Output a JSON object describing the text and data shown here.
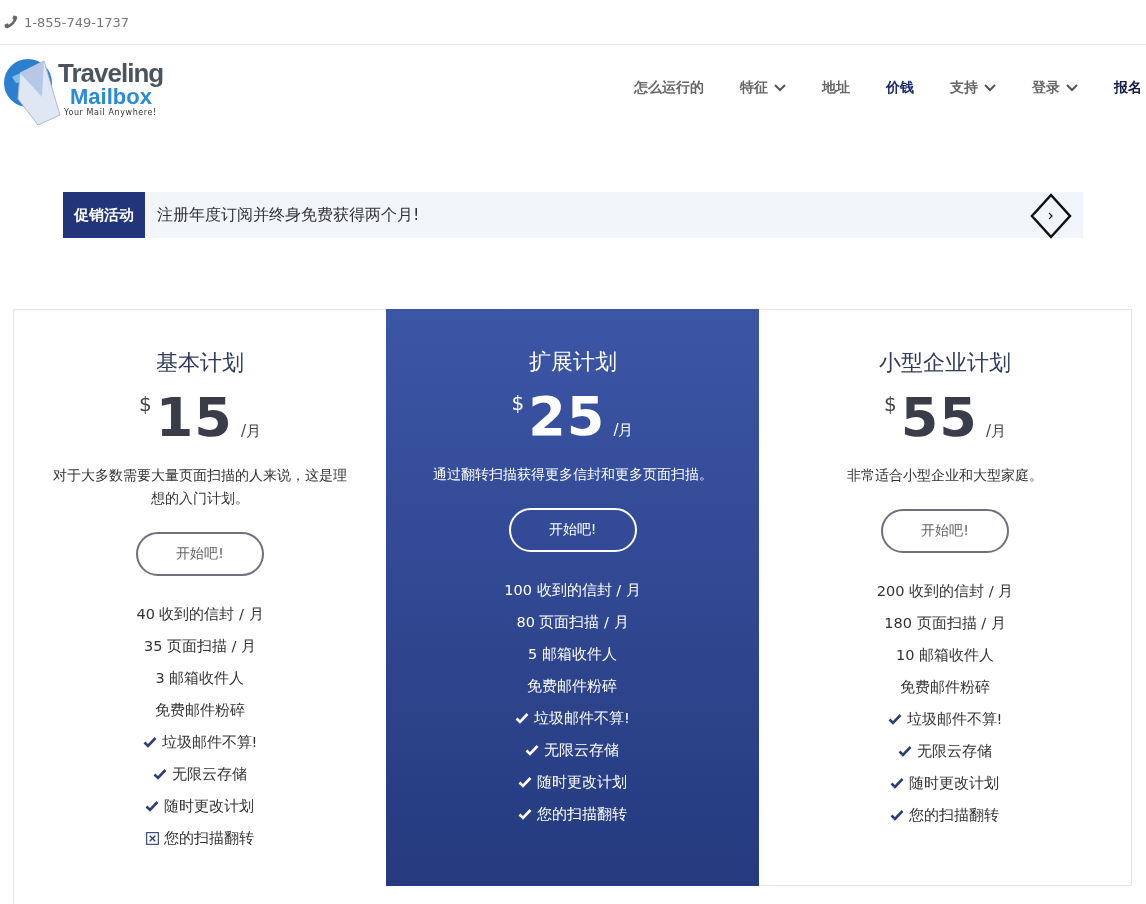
{
  "top_bar": {
    "phone": "1-855-749-1737"
  },
  "logo": {
    "line1": "Traveling",
    "line2": "Mailbox",
    "tagline": "Your Mail Anywhere!"
  },
  "nav": [
    {
      "label": "怎么运行的",
      "kind": "link",
      "selected": false
    },
    {
      "label": "特征",
      "kind": "dropdown",
      "selected": false
    },
    {
      "label": "地址",
      "kind": "link",
      "selected": false
    },
    {
      "label": "价钱",
      "kind": "link",
      "selected": true
    },
    {
      "label": "支持",
      "kind": "dropdown",
      "selected": false
    },
    {
      "label": "登录",
      "kind": "dropdown",
      "selected": false
    },
    {
      "label": "报名",
      "kind": "cta",
      "selected": false
    }
  ],
  "promo": {
    "tag": "促销活动",
    "text": "注册年度订阅并终身免费获得两个月!"
  },
  "plans": [
    {
      "name": "基本计划",
      "currency": "$",
      "price": "15",
      "period": "/月",
      "description": "对于大多数需要大量页面扫描的人来说，这是理想的入门计划。",
      "button": "开始吧!",
      "highlighted": false,
      "features": [
        {
          "text": "40 收到的信封 / 月",
          "kind": "plain"
        },
        {
          "text": "35 页面扫描 / 月",
          "kind": "plain"
        },
        {
          "text": "3 邮箱收件人",
          "kind": "plain"
        },
        {
          "text": "免费邮件粉碎",
          "kind": "plain"
        },
        {
          "text": "垃圾邮件不算!",
          "kind": "check"
        },
        {
          "text": "无限云存储",
          "kind": "check"
        },
        {
          "text": "随时更改计划",
          "kind": "check"
        },
        {
          "text": "您的扫描翻转",
          "kind": "cross"
        }
      ]
    },
    {
      "name": "扩展计划",
      "currency": "$",
      "price": "25",
      "period": "/月",
      "description": "通过翻转扫描获得更多信封和更多页面扫描。",
      "button": "开始吧!",
      "highlighted": true,
      "features": [
        {
          "text": "100 收到的信封 / 月",
          "kind": "plain"
        },
        {
          "text": "80 页面扫描 / 月",
          "kind": "plain"
        },
        {
          "text": "5 邮箱收件人",
          "kind": "plain"
        },
        {
          "text": "免费邮件粉碎",
          "kind": "plain"
        },
        {
          "text": "垃圾邮件不算!",
          "kind": "check"
        },
        {
          "text": "无限云存储",
          "kind": "check"
        },
        {
          "text": "随时更改计划",
          "kind": "check"
        },
        {
          "text": "您的扫描翻转",
          "kind": "check"
        }
      ]
    },
    {
      "name": "小型企业计划",
      "currency": "$",
      "price": "55",
      "period": "/月",
      "description": "非常适合小型企业和大型家庭。",
      "button": "开始吧!",
      "highlighted": false,
      "features": [
        {
          "text": "200 收到的信封 / 月",
          "kind": "plain"
        },
        {
          "text": "180 页面扫描 / 月",
          "kind": "plain"
        },
        {
          "text": "10 邮箱收件人",
          "kind": "plain"
        },
        {
          "text": "免费邮件粉碎",
          "kind": "plain"
        },
        {
          "text": "垃圾邮件不算!",
          "kind": "check"
        },
        {
          "text": "无限云存储",
          "kind": "check"
        },
        {
          "text": "随时更改计划",
          "kind": "check"
        },
        {
          "text": "您的扫描翻转",
          "kind": "check"
        }
      ]
    }
  ]
}
